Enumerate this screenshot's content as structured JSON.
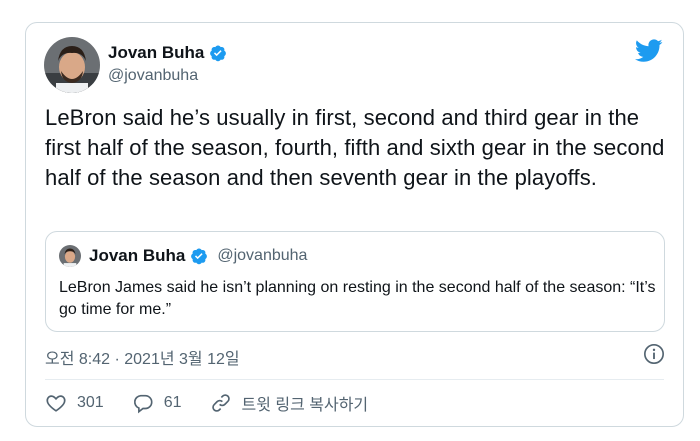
{
  "tweet": {
    "author_name": "Jovan Buha",
    "author_handle": "@jovanbuha",
    "text": "LeBron said he’s usually in first, second and third gear in the first half of the season, fourth, fifth and sixth gear in the second half of the season and then seventh gear in the playoffs.",
    "timestamp": "오전 8:42 · 2021년 3월 12일"
  },
  "quoted": {
    "author_name": "Jovan Buha",
    "author_handle": "@jovanbuha",
    "text": "LeBron James said he isn’t planning on resting in the second half of the season: “It’s go time for me.”"
  },
  "actions": {
    "likes": "301",
    "replies": "61",
    "copy_link_label": "트윗 링크 복사하기"
  },
  "icons": {
    "brand": "twitter-bird-icon",
    "verified": "verified-badge-icon",
    "info": "info-icon",
    "like": "heart-icon",
    "reply": "reply-bubble-icon",
    "link": "link-icon"
  },
  "colors": {
    "brand_blue": "#1d9bf0",
    "text": "#0f1419",
    "muted": "#536471",
    "border": "#cfd9de"
  }
}
